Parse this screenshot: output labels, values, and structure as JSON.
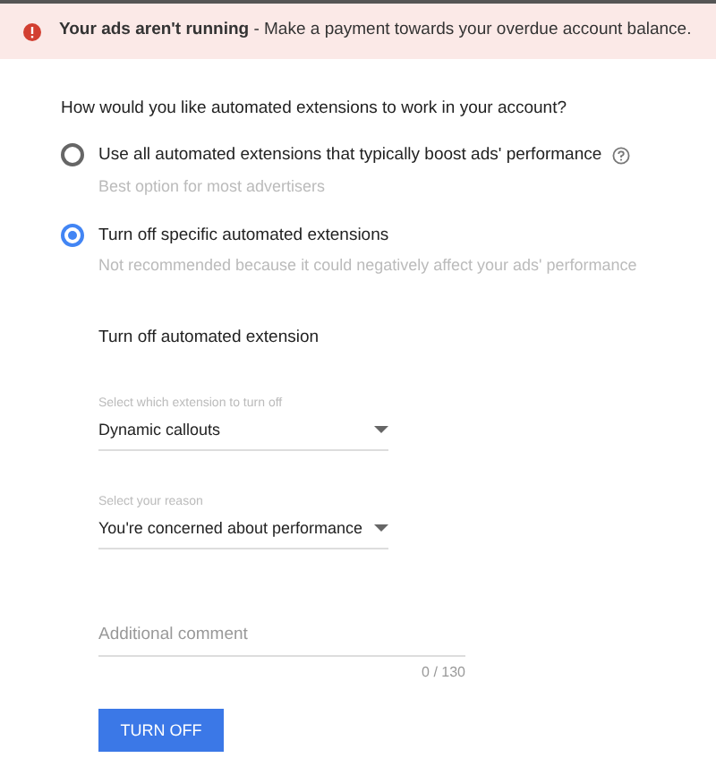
{
  "alert": {
    "title": "Your ads aren't running",
    "message": " - Make a payment towards your overdue account balance."
  },
  "question": "How would you like automated extensions to work in your account?",
  "options": [
    {
      "label": "Use all automated extensions that typically boost ads' performance",
      "hint": "Best option for most advertisers",
      "selected": false,
      "help": true
    },
    {
      "label": "Turn off specific automated extensions",
      "hint": "Not recommended because it could negatively affect your ads' performance",
      "selected": true,
      "help": false
    }
  ],
  "section_title": "Turn off automated extension",
  "selects": [
    {
      "label": "Select which extension to turn off",
      "value": "Dynamic callouts"
    },
    {
      "label": "Select your reason",
      "value": "You're concerned about performance"
    }
  ],
  "comment": {
    "placeholder": "Additional comment",
    "counter": "0 / 130"
  },
  "button": "TURN OFF"
}
